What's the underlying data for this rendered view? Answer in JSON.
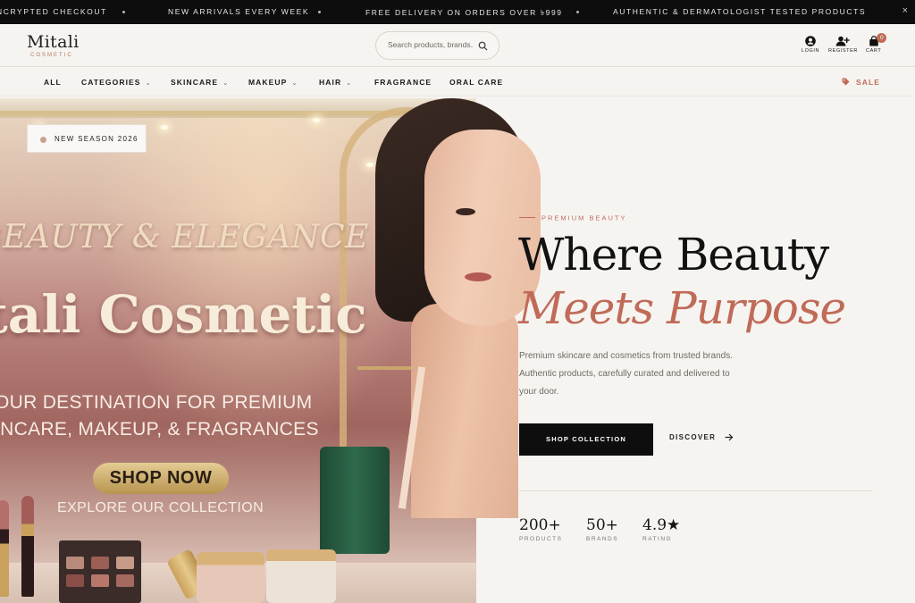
{
  "announcements": [
    "NCRYPTED CHECKOUT",
    "NEW ARRIVALS EVERY WEEK",
    "FREE DELIVERY ON ORDERS OVER ৳999",
    "AUTHENTIC & DERMATOLOGIST TESTED PRODUCTS"
  ],
  "announce_close": "×",
  "header": {
    "logo_name": "Mitali",
    "logo_sub": "COSMETIC",
    "search_placeholder": "Search products, brands...",
    "login": "LOGIN",
    "register": "REGISTER",
    "cart": "CART",
    "cart_count": "0"
  },
  "nav": {
    "items": [
      "ALL",
      "CATEGORIES",
      "SKINCARE",
      "MAKEUP",
      "HAIR",
      "FRAGRANCE",
      "ORAL CARE"
    ],
    "sale": "SALE",
    "chevron": "⌄"
  },
  "hero_image": {
    "badge": "NEW SEASON 2026",
    "title1": "BEAUTY & ELEGANCE",
    "title2": "tali Cosmetic",
    "sub_line1": "OUR DESTINATION FOR PREMIUM",
    "sub_line2": "INCARE, MAKEUP, & FRAGRANCES",
    "shop_now": "SHOP NOW",
    "explore": "EXPLORE OUR COLLECTION"
  },
  "hero_text": {
    "eyebrow": "PREMIUM BEAUTY",
    "heading_line1": "Where Beauty",
    "heading_line2": "Meets Purpose",
    "description": "Premium skincare and cosmetics from trusted brands. Authentic products, carefully curated and delivered to your door.",
    "cta_primary": "SHOP COLLECTION",
    "cta_secondary": "DISCOVER"
  },
  "stats": [
    {
      "value": "200+",
      "label": "PRODUCTS"
    },
    {
      "value": "50+",
      "label": "BRANDS"
    },
    {
      "value": "4.9★",
      "label": "RATING"
    }
  ],
  "colors": {
    "accent": "#c06b58",
    "dark": "#0e0e0e",
    "background": "#f6f4f1"
  }
}
